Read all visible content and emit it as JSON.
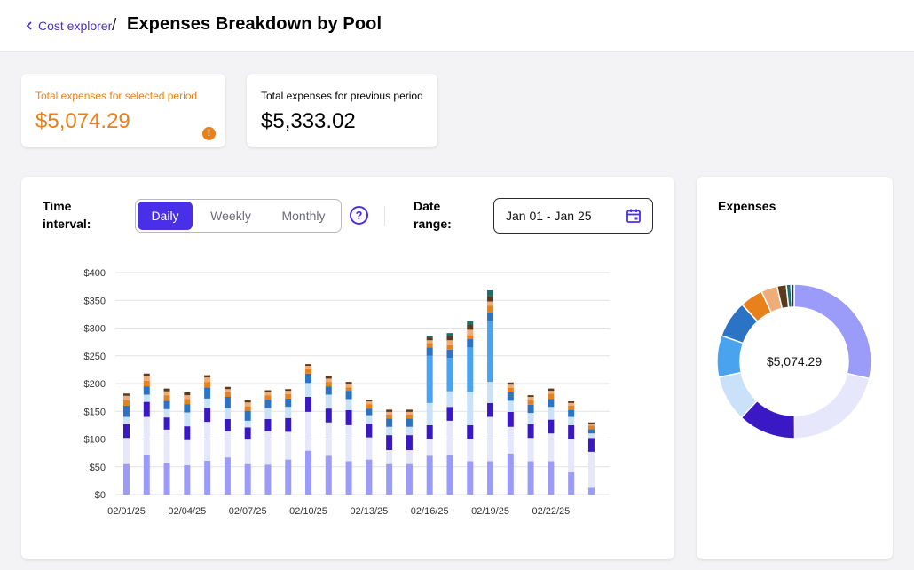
{
  "header": {
    "breadcrumb_label": "Cost explorer",
    "separator": "/",
    "title": "Expenses Breakdown by Pool"
  },
  "summary": {
    "selected": {
      "label": "Total expenses for selected period",
      "value": "$5,074.29",
      "warning_icon": "exclamation-icon"
    },
    "previous": {
      "label": "Total expenses for previous period",
      "value": "$5,333.02"
    }
  },
  "controls": {
    "time_interval_label_line1": "Time",
    "time_interval_label_line2": "interval:",
    "options": [
      "Daily",
      "Weekly",
      "Monthly"
    ],
    "selected_option": "Daily",
    "help_icon": "question-circle-icon",
    "date_range_label_line1": "Date",
    "date_range_label_line2": "range:",
    "date_range_value": "Jan 01 - Jan 25",
    "calendar_icon": "calendar-icon"
  },
  "colors": {
    "accent": "#4a2fe8",
    "warning": "#e8801c",
    "series": [
      "#9b9bfa",
      "#e6e7fb",
      "#3a19c4",
      "#c9e2f9",
      "#4aa3ef",
      "#2b73c5",
      "#e8801c",
      "#eeac79",
      "#5c3a1e",
      "#1b6e72"
    ]
  },
  "chart_data": {
    "type": "bar",
    "stacked": true,
    "ylim": [
      0,
      400
    ],
    "yticks": [
      "$0",
      "$50",
      "$100",
      "$150",
      "$200",
      "$250",
      "$300",
      "$350",
      "$400"
    ],
    "xtick_labels": [
      "02/01/25",
      "02/04/25",
      "02/07/25",
      "02/10/25",
      "02/13/25",
      "02/16/25",
      "02/19/25",
      "02/22/25"
    ],
    "grid": true,
    "categories": [
      "02/01/25",
      "02/02/25",
      "02/03/25",
      "02/04/25",
      "02/05/25",
      "02/06/25",
      "02/07/25",
      "02/08/25",
      "02/09/25",
      "02/10/25",
      "02/11/25",
      "02/12/25",
      "02/13/25",
      "02/14/25",
      "02/15/25",
      "02/16/25",
      "02/17/25",
      "02/18/25",
      "02/19/25",
      "02/20/25",
      "02/21/25",
      "02/22/25",
      "02/23/25",
      "02/24/25"
    ],
    "series": [
      {
        "values": [
          55,
          72,
          57,
          53,
          61,
          67,
          55,
          54,
          63,
          79,
          70,
          60,
          63,
          55,
          55,
          70,
          71,
          60,
          60,
          74,
          60,
          60,
          40,
          12
        ]
      },
      {
        "values": [
          47,
          68,
          60,
          45,
          70,
          47,
          44,
          60,
          50,
          70,
          60,
          65,
          40,
          25,
          25,
          30,
          62,
          40,
          80,
          48,
          42,
          50,
          60,
          65
        ]
      },
      {
        "values": [
          25,
          27,
          22,
          25,
          25,
          22,
          22,
          22,
          25,
          27,
          25,
          27,
          25,
          27,
          27,
          25,
          25,
          25,
          25,
          27,
          25,
          25,
          25,
          25
        ]
      },
      {
        "values": [
          13,
          13,
          15,
          25,
          17,
          20,
          12,
          20,
          20,
          25,
          25,
          20,
          15,
          15,
          15,
          40,
          28,
          60,
          38,
          20,
          20,
          23,
          15,
          8
        ]
      },
      {
        "values": [
          0,
          0,
          0,
          0,
          0,
          0,
          0,
          0,
          0,
          0,
          0,
          0,
          0,
          0,
          0,
          85,
          60,
          80,
          110,
          0,
          0,
          0,
          0,
          0
        ]
      },
      {
        "values": [
          20,
          15,
          15,
          15,
          20,
          20,
          18,
          15,
          15,
          17,
          15,
          15,
          12,
          15,
          15,
          15,
          15,
          15,
          15,
          15,
          15,
          14,
          12,
          8
        ]
      },
      {
        "values": [
          10,
          10,
          10,
          9,
          10,
          8,
          8,
          8,
          8,
          8,
          8,
          6,
          8,
          7,
          7,
          8,
          8,
          7,
          12,
          8,
          8,
          10,
          8,
          6
        ]
      },
      {
        "values": [
          8,
          8,
          7,
          7,
          8,
          6,
          7,
          6,
          6,
          6,
          6,
          6,
          5,
          5,
          5,
          5,
          9,
          10,
          8,
          6,
          6,
          5,
          5,
          3
        ]
      },
      {
        "values": [
          4,
          5,
          5,
          5,
          4,
          4,
          4,
          3,
          3,
          3,
          4,
          4,
          3,
          4,
          4,
          5,
          8,
          10,
          10,
          4,
          3,
          4,
          3,
          3
        ]
      },
      {
        "values": [
          0,
          0,
          0,
          0,
          0,
          0,
          0,
          0,
          0,
          0,
          0,
          0,
          0,
          0,
          0,
          3,
          5,
          5,
          10,
          0,
          0,
          0,
          0,
          0
        ]
      }
    ]
  },
  "donut": {
    "title": "Expenses",
    "center_value": "$5,074.29",
    "slices": [
      29.5,
      22.0,
      12.5,
      10.0,
      9.0,
      8.0,
      5.0,
      3.5,
      2.0,
      1.0,
      0.7
    ]
  }
}
